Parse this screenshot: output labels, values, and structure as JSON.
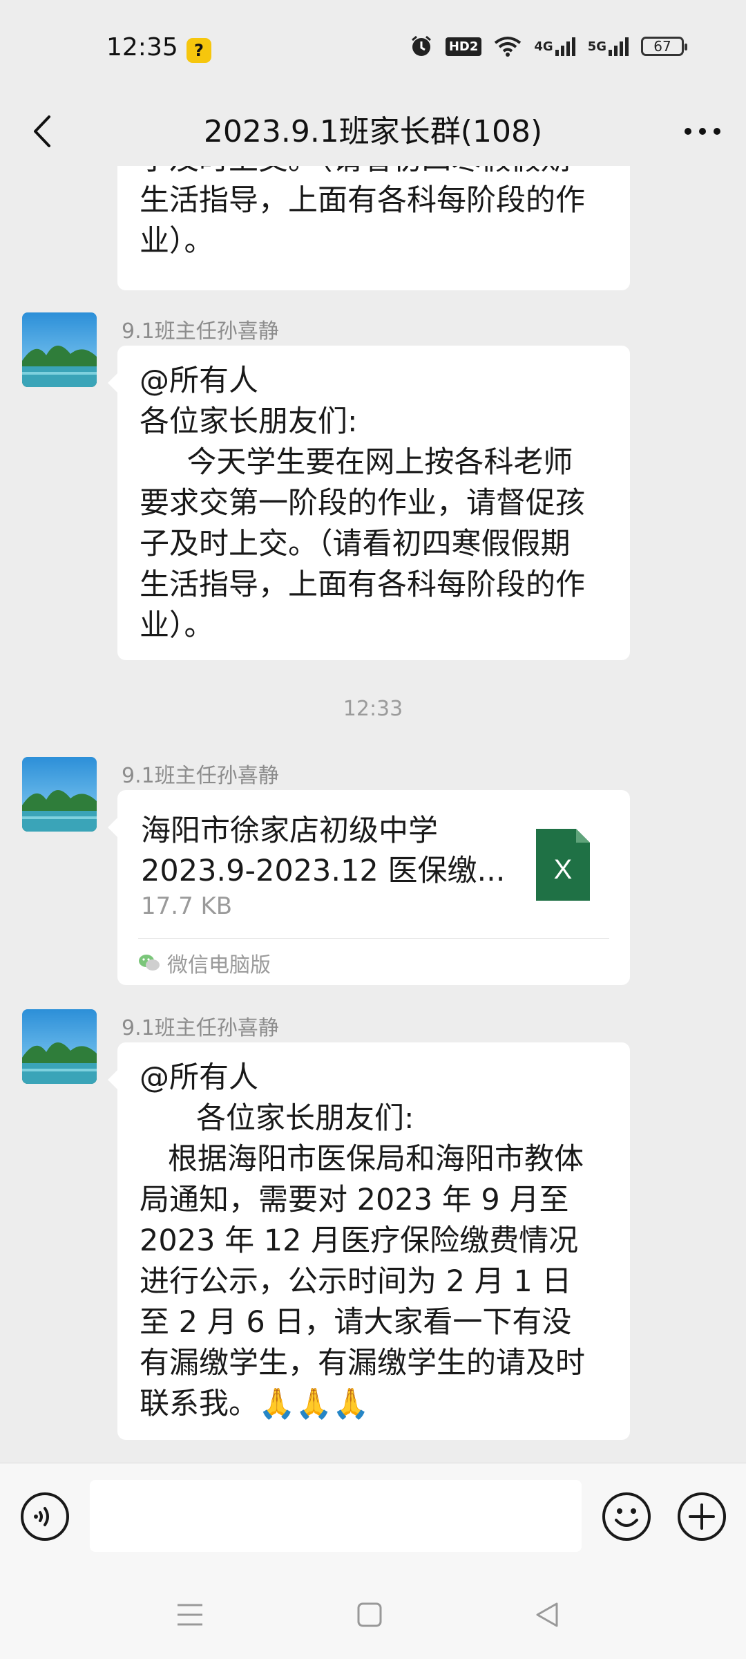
{
  "status_bar": {
    "time": "12:35",
    "hd_label": "HD2",
    "net1": "4G",
    "net2": "5G",
    "battery": "67"
  },
  "header": {
    "title": "2023.9.1班家长群(108)"
  },
  "messages": {
    "top_partial": "子及时上交。（请看初四寒假假期\n生活指导，上面有各科每阶段的作\n业）。",
    "msg1": {
      "sender": "9.1班主任孙喜静",
      "text": "@所有人\n各位家长朋友们:\n     今天学生要在网上按各科老师\n要求交第一阶段的作业，请督促孩\n子及时上交。（请看初四寒假假期\n生活指导，上面有各科每阶段的作\n业）。"
    },
    "timestamp": "12:33",
    "file_msg": {
      "sender": "9.1班主任孙喜静",
      "file_name": "海阳市徐家店初级中学\n2023.9-2023.12 医保缴...",
      "file_size": "17.7 KB",
      "source": "微信电脑版",
      "file_icon_letter": "X"
    },
    "msg2": {
      "sender": "9.1班主任孙喜静",
      "text": "@所有人\n      各位家长朋友们:\n   根据海阳市医保局和海阳市教体\n局通知，需要对 2023 年 9 月至\n2023 年 12 月医疗保险缴费情况\n进行公示，公示时间为 2 月 1 日\n至 2 月 6 日，请大家看一下有没\n有漏缴学生，有漏缴学生的请及时\n联系我。🙏🙏🙏"
    }
  },
  "input": {
    "placeholder": ""
  },
  "colors": {
    "background": "#ededed",
    "bubble": "#ffffff",
    "excel_green": "#1f7145"
  }
}
